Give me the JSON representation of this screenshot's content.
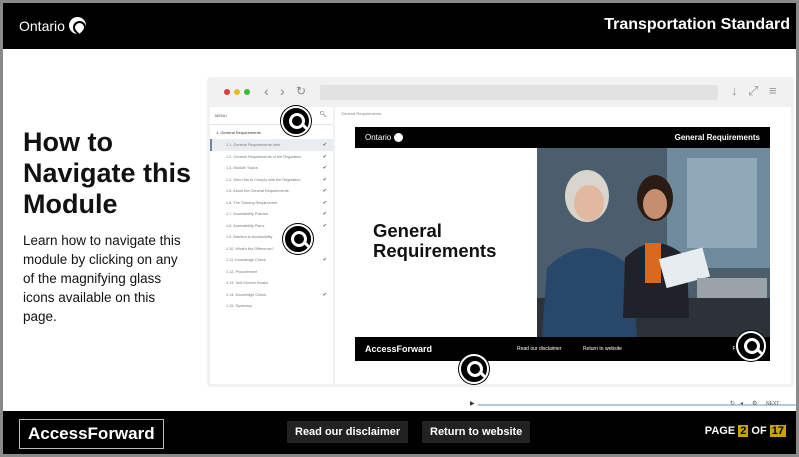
{
  "header": {
    "logo": "Ontario",
    "title": "Transportation Standard"
  },
  "intro": {
    "heading": "How to Navigate this Module",
    "body": "Learn how to navigate this module by clicking on any of the magnifying glass icons available on this page."
  },
  "browser": {
    "sidebar": {
      "menu_label": "MENU",
      "section": "1. General Requirements",
      "items": [
        "1.1. General Requirements Intro",
        "1.2. General Requirements of the Regulation",
        "1.3. Module Topics",
        "1.4. Who Has to Comply with the Regulation",
        "1.5. About the General Requirements",
        "1.6. The Training Requirement",
        "1.7. Accessibility Policies",
        "1.8. Accessibility Plans",
        "1.9. Barriers to Accessibility",
        "1.10. What's the Difference?",
        "1.11. Knowledge Check",
        "1.12. Procurement",
        "1.13. Self-Service Kiosks",
        "1.14. Knowledge Check",
        "1.15. Summary"
      ]
    },
    "content": {
      "breadcrumb": "General Requirements",
      "inner_logo": "Ontario",
      "inner_title": "General Requirements",
      "inner_heading": "General Requirements",
      "inner_brand": "AccessForward",
      "inner_disclaimer": "Read our disclaimer",
      "inner_return": "Return to website",
      "inner_page": "PAGE",
      "next_label": "NEXT"
    }
  },
  "footer": {
    "brand": "AccessForward",
    "disclaimer": "Read our disclaimer",
    "return": "Return to website",
    "page_prefix": "PAGE",
    "page_current": "2",
    "page_of": "OF",
    "page_total": "17"
  },
  "colors": {
    "accent": "#c9a400",
    "bar": "#000000",
    "active_item": "#6b86a8"
  },
  "icons": [
    "search-icon",
    "ontario-trillium-icon",
    "check-icon",
    "play-icon"
  ]
}
